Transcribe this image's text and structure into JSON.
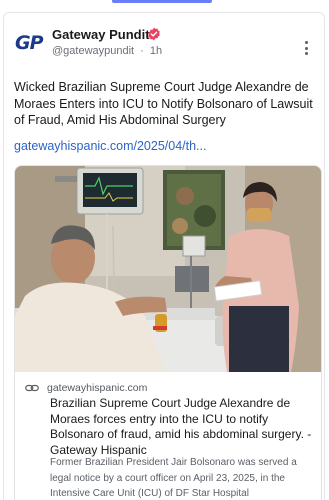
{
  "post": {
    "author": {
      "name": "Gateway Pundit",
      "handle": "@gatewaypundit",
      "separator": "·",
      "time": "1h",
      "avatar_text": "GP"
    },
    "text": "Wicked Brazilian Supreme Court Judge Alexandre de Moraes Enters into ICU to Notify Bolsonaro of Lawsuit of Fraud, Amid His Abdominal Surgery",
    "link": "gatewayhispanic.com/2025/04/th...",
    "embed": {
      "domain": "gatewayhispanic.com",
      "title": "Brazilian Supreme Court Judge Alexandre de Moraes forces entry into the ICU to notify Bolsonaro of fraud, amid his abdominal surgery. - Gateway Hispanic",
      "description": "Former Brazilian President Jair Bolsonaro was served a legal notice by a court officer on April 23, 2025, in the Intensive Care Unit (ICU) of DF Star Hospital"
    }
  },
  "colors": {
    "accent": "#6a7ef5",
    "verified": "#e8425e",
    "link": "#2c63c9",
    "brand_blue": "#1b3a8c"
  },
  "icons": [
    "verified-badge-icon",
    "more-options-icon",
    "link-icon"
  ]
}
